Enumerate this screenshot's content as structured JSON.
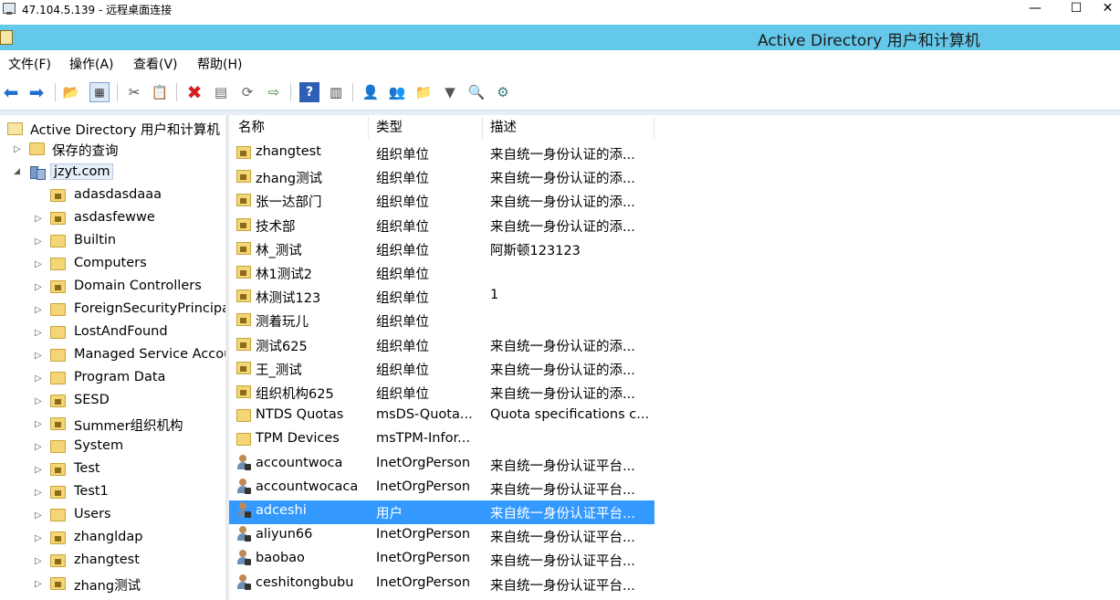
{
  "rdp": {
    "title": "47.104.5.139 - 远程桌面连接",
    "minimize": "—",
    "maximize": "☐",
    "close": "✕"
  },
  "app": {
    "title": "Active Directory 用户和计算机"
  },
  "menu": {
    "items": [
      "文件(F)",
      "操作(A)",
      "查看(V)",
      "帮助(H)"
    ]
  },
  "toolbar": {
    "icons": [
      "back-icon",
      "forward-icon",
      "up-folder-icon",
      "show-hide-tree-icon",
      "cut-icon",
      "copy-icon",
      "delete-icon",
      "properties-icon",
      "refresh-icon",
      "export-icon",
      "help-icon",
      "console-icon",
      "new-user-icon",
      "new-group-icon",
      "new-ou-icon",
      "filter-icon",
      "find-icon",
      "delegate-icon"
    ]
  },
  "tree": {
    "root": "Active Directory 用户和计算机",
    "saved_queries": "保存的查询",
    "domain": "jzyt.com",
    "children": [
      "adasdasdaaa",
      "asdasfewwe",
      "Builtin",
      "Computers",
      "Domain Controllers",
      "ForeignSecurityPrincipals",
      "LostAndFound",
      "Managed Service Accounts",
      "Program Data",
      "SESD",
      "Summer组织机构",
      "System",
      "Test",
      "Test1",
      "Users",
      "zhangldap",
      "zhangtest",
      "zhang测试"
    ]
  },
  "list": {
    "columns": [
      "名称",
      "类型",
      "描述"
    ],
    "rows": [
      {
        "name": "zhangtest",
        "type": "组织单位",
        "desc": "来自统一身份认证的添...",
        "icon": "ou"
      },
      {
        "name": "zhang测试",
        "type": "组织单位",
        "desc": "来自统一身份认证的添...",
        "icon": "ou"
      },
      {
        "name": "张一达部门",
        "type": "组织单位",
        "desc": "来自统一身份认证的添...",
        "icon": "ou"
      },
      {
        "name": "技术部",
        "type": "组织单位",
        "desc": "来自统一身份认证的添...",
        "icon": "ou"
      },
      {
        "name": "林_测试",
        "type": "组织单位",
        "desc": "阿斯顿123123",
        "icon": "ou"
      },
      {
        "name": "林1测试2",
        "type": "组织单位",
        "desc": "",
        "icon": "ou"
      },
      {
        "name": "林测试123",
        "type": "组织单位",
        "desc": "1",
        "icon": "ou"
      },
      {
        "name": "测着玩儿",
        "type": "组织单位",
        "desc": "",
        "icon": "ou"
      },
      {
        "name": "测试625",
        "type": "组织单位",
        "desc": "来自统一身份认证的添...",
        "icon": "ou"
      },
      {
        "name": "王_测试",
        "type": "组织单位",
        "desc": "来自统一身份认证的添...",
        "icon": "ou"
      },
      {
        "name": "组织机构625",
        "type": "组织单位",
        "desc": "来自统一身份认证的添...",
        "icon": "ou"
      },
      {
        "name": "NTDS Quotas",
        "type": "msDS-Quota...",
        "desc": "Quota specifications c...",
        "icon": "folder"
      },
      {
        "name": "TPM Devices",
        "type": "msTPM-Infor...",
        "desc": "",
        "icon": "folder"
      },
      {
        "name": "accountwoca",
        "type": "InetOrgPerson",
        "desc": "来自统一身份认证平台...",
        "icon": "user"
      },
      {
        "name": "accountwocaca",
        "type": "InetOrgPerson",
        "desc": "来自统一身份认证平台...",
        "icon": "user"
      },
      {
        "name": "adceshi",
        "type": "用户",
        "desc": "来自统一身份认证平台...",
        "icon": "user",
        "selected": true
      },
      {
        "name": "aliyun66",
        "type": "InetOrgPerson",
        "desc": "来自统一身份认证平台...",
        "icon": "user"
      },
      {
        "name": "baobao",
        "type": "InetOrgPerson",
        "desc": "来自统一身份认证平台...",
        "icon": "user"
      },
      {
        "name": "ceshitongbubu",
        "type": "InetOrgPerson",
        "desc": "来自统一身份认证平台...",
        "icon": "user"
      }
    ]
  }
}
